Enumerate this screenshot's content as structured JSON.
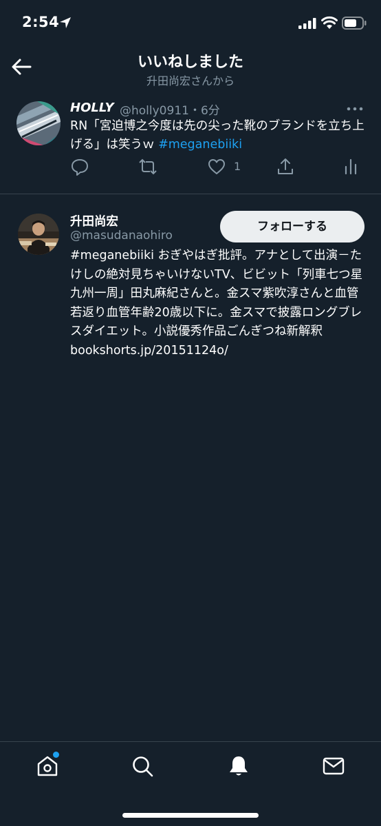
{
  "status_bar": {
    "time": "2:54"
  },
  "header": {
    "title": "いいねしました",
    "subtitle": "升田尚宏さんから"
  },
  "liked_tweet": {
    "name": "HOLLY",
    "handle_time": "@holly0911・6分",
    "text": "RN「宮迫博之今度は先の尖った靴のブランドを立ち上げる」は笑うｗ ",
    "hashtag": "#meganebiiki",
    "like_count": "1"
  },
  "user_tweet": {
    "name": "升田尚宏",
    "handle": "@masudanaohiro",
    "follow_label": "フォローする",
    "text": "#meganebiiki おぎやはぎ批評。アナとして出演－たけしの絶対見ちゃいけないTV、ビビット「列車七つ星九州一周」田丸麻紀さんと。金スマ紫吹淳さんと血管若返り血管年齢20歳以下に。金スマで披露ロングブレスダイエット。小説優秀作品ごんぎつね新解釈 bookshorts.jp/20151124o/"
  },
  "tabbar": {
    "items": [
      "home-icon",
      "search-icon",
      "notifications-icon",
      "messages-icon"
    ],
    "home_has_badge": true
  },
  "colors": {
    "background": "#15202b",
    "accent": "#1da1f2",
    "secondary_text": "#8899a6",
    "divider": "#38444d"
  }
}
